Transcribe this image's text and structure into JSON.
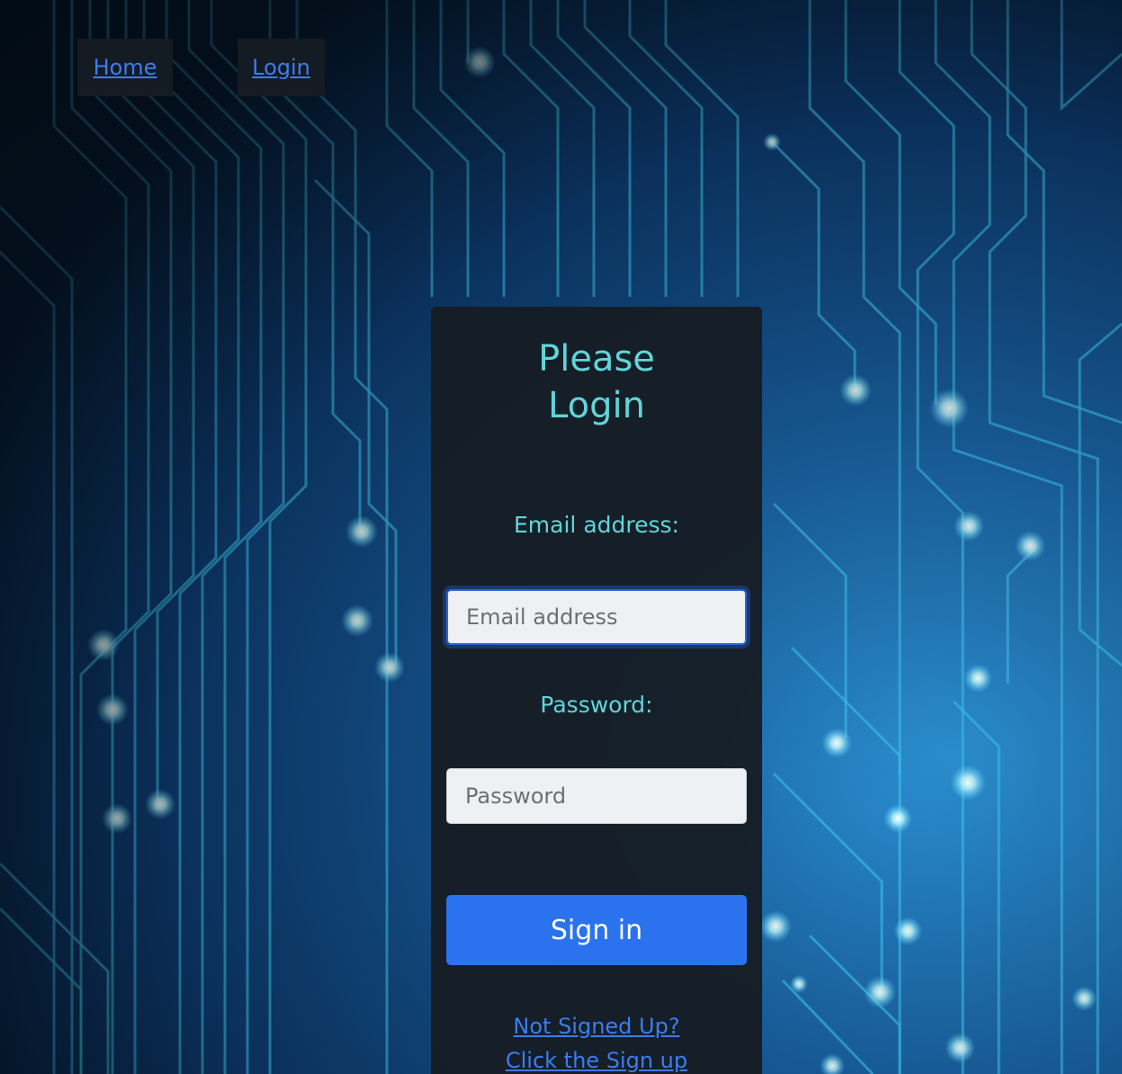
{
  "nav": {
    "home_label": "Home",
    "login_label": "Login"
  },
  "login_card": {
    "title_line1": "Please",
    "title_line2": "Login",
    "email_label": "Email address:",
    "email_placeholder": "Email address",
    "email_value": "",
    "password_label": "Password:",
    "password_placeholder": "Password",
    "password_value": "",
    "sign_in_label": "Sign in",
    "signup_prompt": "Not Signed Up?",
    "signup_link": "Click the Sign up"
  },
  "colors": {
    "accent_teal": "#5fd6d9",
    "link_blue": "#3b7df0",
    "button_blue": "#2a72ee",
    "card_bg": "#161c22",
    "background": "circuit-board-blue"
  }
}
